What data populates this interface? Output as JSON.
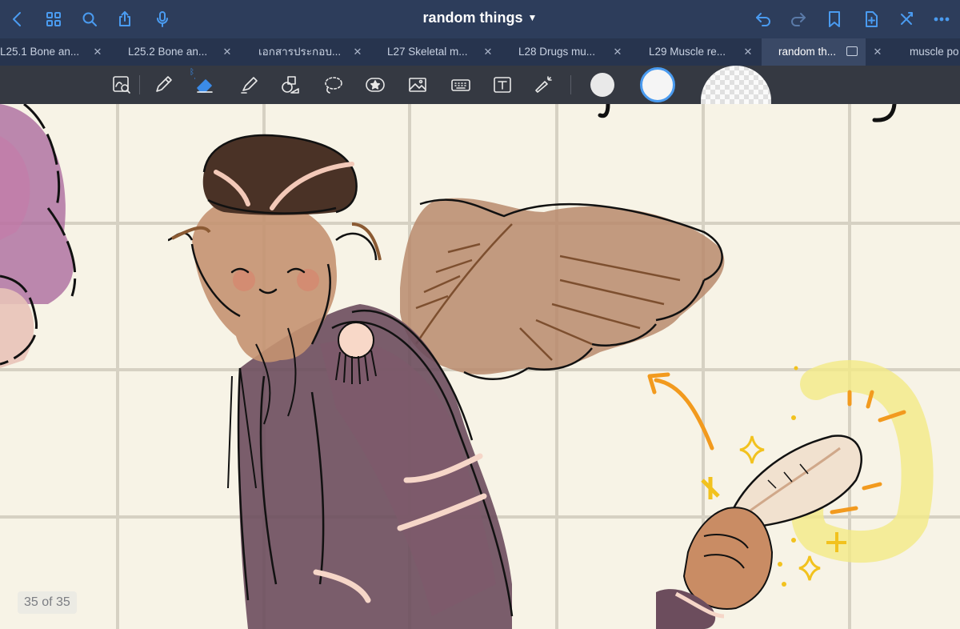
{
  "header": {
    "title": "random things",
    "title_dropdown_icon": "chevron-down-icon",
    "left_icons": [
      "back-icon",
      "grid-icon",
      "search-icon",
      "share-icon",
      "mic-icon"
    ],
    "right_icons": [
      "undo-icon",
      "redo-icon",
      "bookmark-icon",
      "add-page-icon",
      "close-tool-icon",
      "more-icon"
    ]
  },
  "tabs": [
    {
      "label": "L25.1 Bone an..."
    },
    {
      "label": "L25.2 Bone an..."
    },
    {
      "label": "เอกสารประกอบ..."
    },
    {
      "label": "L27 Skeletal m..."
    },
    {
      "label": "L28 Drugs mu..."
    },
    {
      "label": "L29 Muscle re..."
    },
    {
      "label": "random th...",
      "active": true
    },
    {
      "label": "muscle po"
    }
  ],
  "toolbar": {
    "tools": [
      "lasso-zoom-icon",
      "pen-icon",
      "eraser-icon",
      "highlighter-icon",
      "shapes-icon",
      "lasso-icon",
      "sticker-icon",
      "image-icon",
      "keyboard-icon",
      "text-icon",
      "laser-pointer-icon"
    ],
    "active_tool": "eraser-icon",
    "size_options": [
      "small",
      "medium",
      "large"
    ],
    "selected_size": "medium"
  },
  "page_counter": "35 of 35",
  "colors": {
    "header_bg": "#2d3d5b",
    "tabbar_bg": "#27344e",
    "toolbar_bg": "#353942",
    "accent": "#4a9bf0",
    "paper": "#f7f3e6",
    "grid": "#d6d1c3"
  }
}
